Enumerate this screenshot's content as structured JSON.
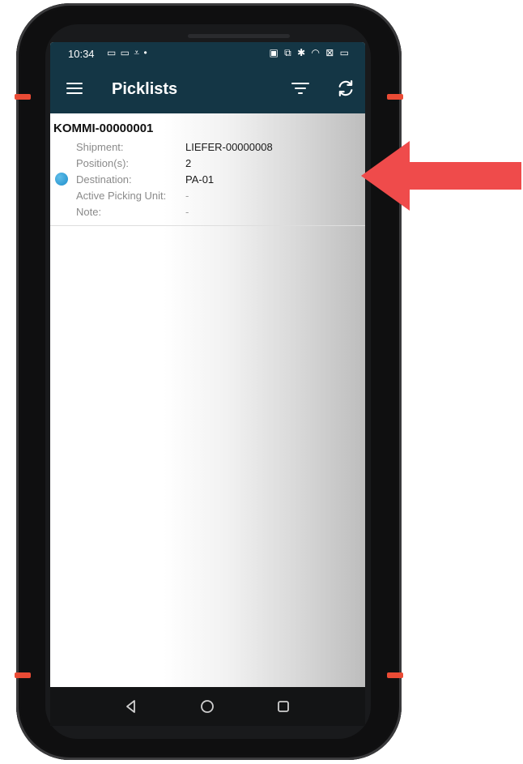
{
  "status_bar": {
    "time": "10:34",
    "left_icons": "▭ ▭ ⩡ •",
    "right_icons": "▣ ⧉ ✱ ◠ ⊠ ▭"
  },
  "app_bar": {
    "title": "Picklists",
    "menu_icon": "hamburger-menu",
    "filter_icon": "filter",
    "refresh_icon": "refresh"
  },
  "picklists": [
    {
      "id": "KOMMI-00000001",
      "status_color": "#2a9ad6",
      "fields": [
        {
          "label": "Shipment:",
          "value": "LIEFER-00000008",
          "muted": false
        },
        {
          "label": "Position(s):",
          "value": "2",
          "muted": false
        },
        {
          "label": "Destination:",
          "value": "PA-01",
          "muted": false
        },
        {
          "label": "Active Picking Unit:",
          "value": "-",
          "muted": true
        },
        {
          "label": "Note:",
          "value": "-",
          "muted": true
        }
      ]
    }
  ],
  "nav_bar": {
    "back_icon": "triangle-back",
    "home_icon": "circle-home",
    "recent_icon": "square-recents"
  },
  "colors": {
    "app_bar": "#143645",
    "accent": "#ea4b35",
    "arrow": "#ef4b4b"
  }
}
